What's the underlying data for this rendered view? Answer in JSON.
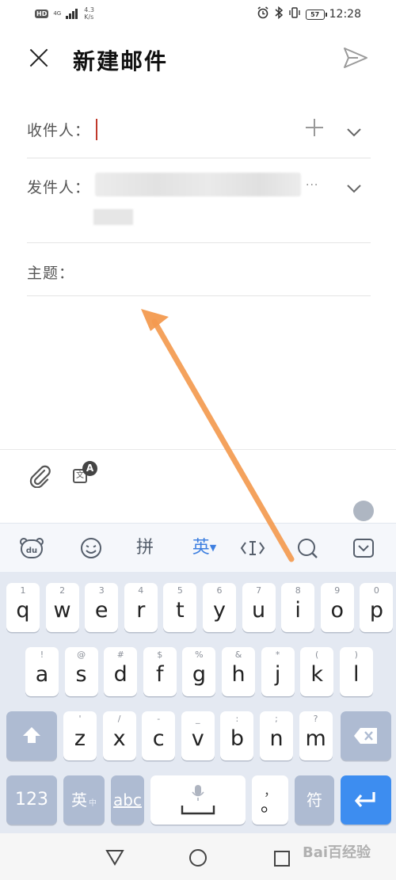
{
  "status_bar": {
    "hd": "HD",
    "network": "4G",
    "speed_value": "4.3",
    "speed_unit": "K/s",
    "battery": "57",
    "time": "12:28"
  },
  "header": {
    "title": "新建邮件"
  },
  "form": {
    "to_label": "收件人：",
    "from_label": "发件人：",
    "from_dots": "···",
    "subject_label": "主题："
  },
  "keyboard": {
    "toolbar": {
      "pinyin": "拼",
      "english": "英"
    },
    "row1": [
      {
        "num": "1",
        "letter": "q"
      },
      {
        "num": "2",
        "letter": "w"
      },
      {
        "num": "3",
        "letter": "e"
      },
      {
        "num": "4",
        "letter": "r"
      },
      {
        "num": "5",
        "letter": "t"
      },
      {
        "num": "6",
        "letter": "y"
      },
      {
        "num": "7",
        "letter": "u"
      },
      {
        "num": "8",
        "letter": "i"
      },
      {
        "num": "9",
        "letter": "o"
      },
      {
        "num": "0",
        "letter": "p"
      }
    ],
    "row2": [
      {
        "num": "!",
        "letter": "a"
      },
      {
        "num": "@",
        "letter": "s"
      },
      {
        "num": "#",
        "letter": "d"
      },
      {
        "num": "$",
        "letter": "f"
      },
      {
        "num": "%",
        "letter": "g"
      },
      {
        "num": "&",
        "letter": "h"
      },
      {
        "num": "*",
        "letter": "j"
      },
      {
        "num": "(",
        "letter": "k"
      },
      {
        "num": ")",
        "letter": "l"
      }
    ],
    "row3": [
      {
        "num": "'",
        "letter": "z"
      },
      {
        "num": "/",
        "letter": "x"
      },
      {
        "num": "-",
        "letter": "c"
      },
      {
        "num": "_",
        "letter": "v"
      },
      {
        "num": ":",
        "letter": "b"
      },
      {
        "num": ";",
        "letter": "n"
      },
      {
        "num": "?",
        "letter": "m"
      }
    ],
    "bottom": {
      "numbers": "123",
      "lang": "英",
      "lang_sub": "中",
      "abc": "abc",
      "comma": "，",
      "period": "。",
      "symbols": "符"
    }
  },
  "watermark": "Bai百经验"
}
